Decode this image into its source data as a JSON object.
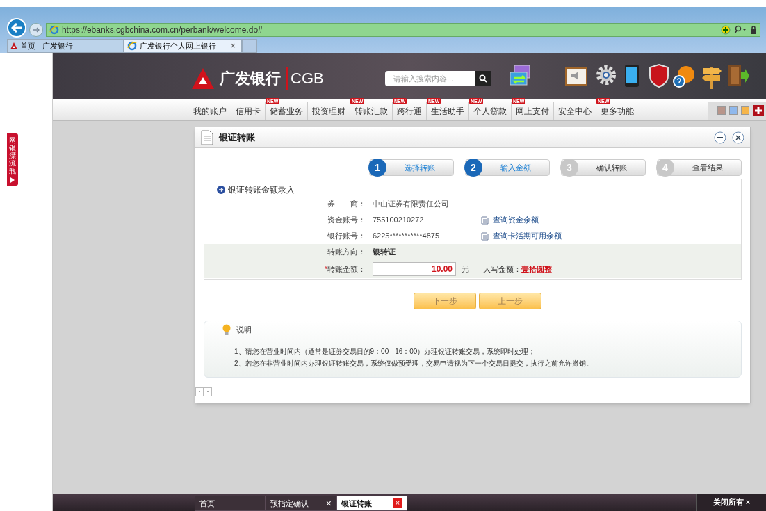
{
  "browser": {
    "url": "https://ebanks.cgbchina.com.cn/perbank/welcome.do#",
    "tabs": [
      {
        "label": "首页 - 广发银行",
        "selected": false
      },
      {
        "label": "广发银行个人网上银行",
        "selected": true,
        "close": "×"
      }
    ]
  },
  "header": {
    "brand": "广发银行",
    "brand_en": "CGB",
    "search": {
      "placeholder": "请输入搜索内容..."
    }
  },
  "nav": [
    {
      "label": "我的账户"
    },
    {
      "label": "信用卡"
    },
    {
      "label": "储蓄业务",
      "badge": "NEW"
    },
    {
      "label": "投资理财"
    },
    {
      "label": "转账汇款",
      "badge": "NEW"
    },
    {
      "label": "跨行通",
      "badge": "NEW"
    },
    {
      "label": "生活助手",
      "badge": "NEW"
    },
    {
      "label": "个人贷款",
      "badge": "NEW"
    },
    {
      "label": "网上支付",
      "badge": "NEW"
    },
    {
      "label": "安全中心"
    },
    {
      "label": "更多功能",
      "badge": "NEW"
    }
  ],
  "side_tab": "网银漂流瓶",
  "dialog": {
    "title": "银证转账",
    "steps": [
      {
        "number": "1",
        "label": "选择转账",
        "done": true
      },
      {
        "number": "2",
        "label": "输入金额",
        "done": true
      },
      {
        "number": "3",
        "label": "确认转账",
        "done": false
      },
      {
        "number": "4",
        "label": "查看结果",
        "done": false
      }
    ],
    "section_title": "银证转账金额录入",
    "fields": [
      {
        "kind": "text",
        "label": "券　　商：",
        "value": "中山证券有限责任公司"
      },
      {
        "kind": "text",
        "label": "资金账号：",
        "value": "755100210272",
        "link": "查询资金余额"
      },
      {
        "kind": "text",
        "label": "银行账号：",
        "value": "6225***********4875",
        "link": "查询卡活期可用余额"
      },
      {
        "kind": "strong",
        "label": "转账方向：",
        "value": "银转证"
      },
      {
        "kind": "amount",
        "required": "*",
        "label": "转账金额：",
        "value": "10.00",
        "unit": "元",
        "caps_label": "大写金额：",
        "caps_value": "壹拾圆整"
      }
    ],
    "buttons": [
      "下一步",
      "上一步"
    ],
    "notes_title": "说明",
    "notes": [
      "1、请您在营业时间内（通常是证券交易日的9：00 - 16：00）办理银证转账交易，系统即时处理；",
      "2、若您在非营业时间内办理银证转账交易，系统仅做预受理，交易申请视为下一个交易日提交，执行之前允许撤销。"
    ],
    "pager": [
      "·",
      "·"
    ]
  },
  "taskbar": {
    "tabs": [
      {
        "label": "首页",
        "selected": false
      },
      {
        "label": "预指定确认",
        "selected": false,
        "close": "×"
      },
      {
        "label": "银证转账",
        "selected": true,
        "close": "×"
      }
    ],
    "close_all": "关闭所有 ×"
  }
}
